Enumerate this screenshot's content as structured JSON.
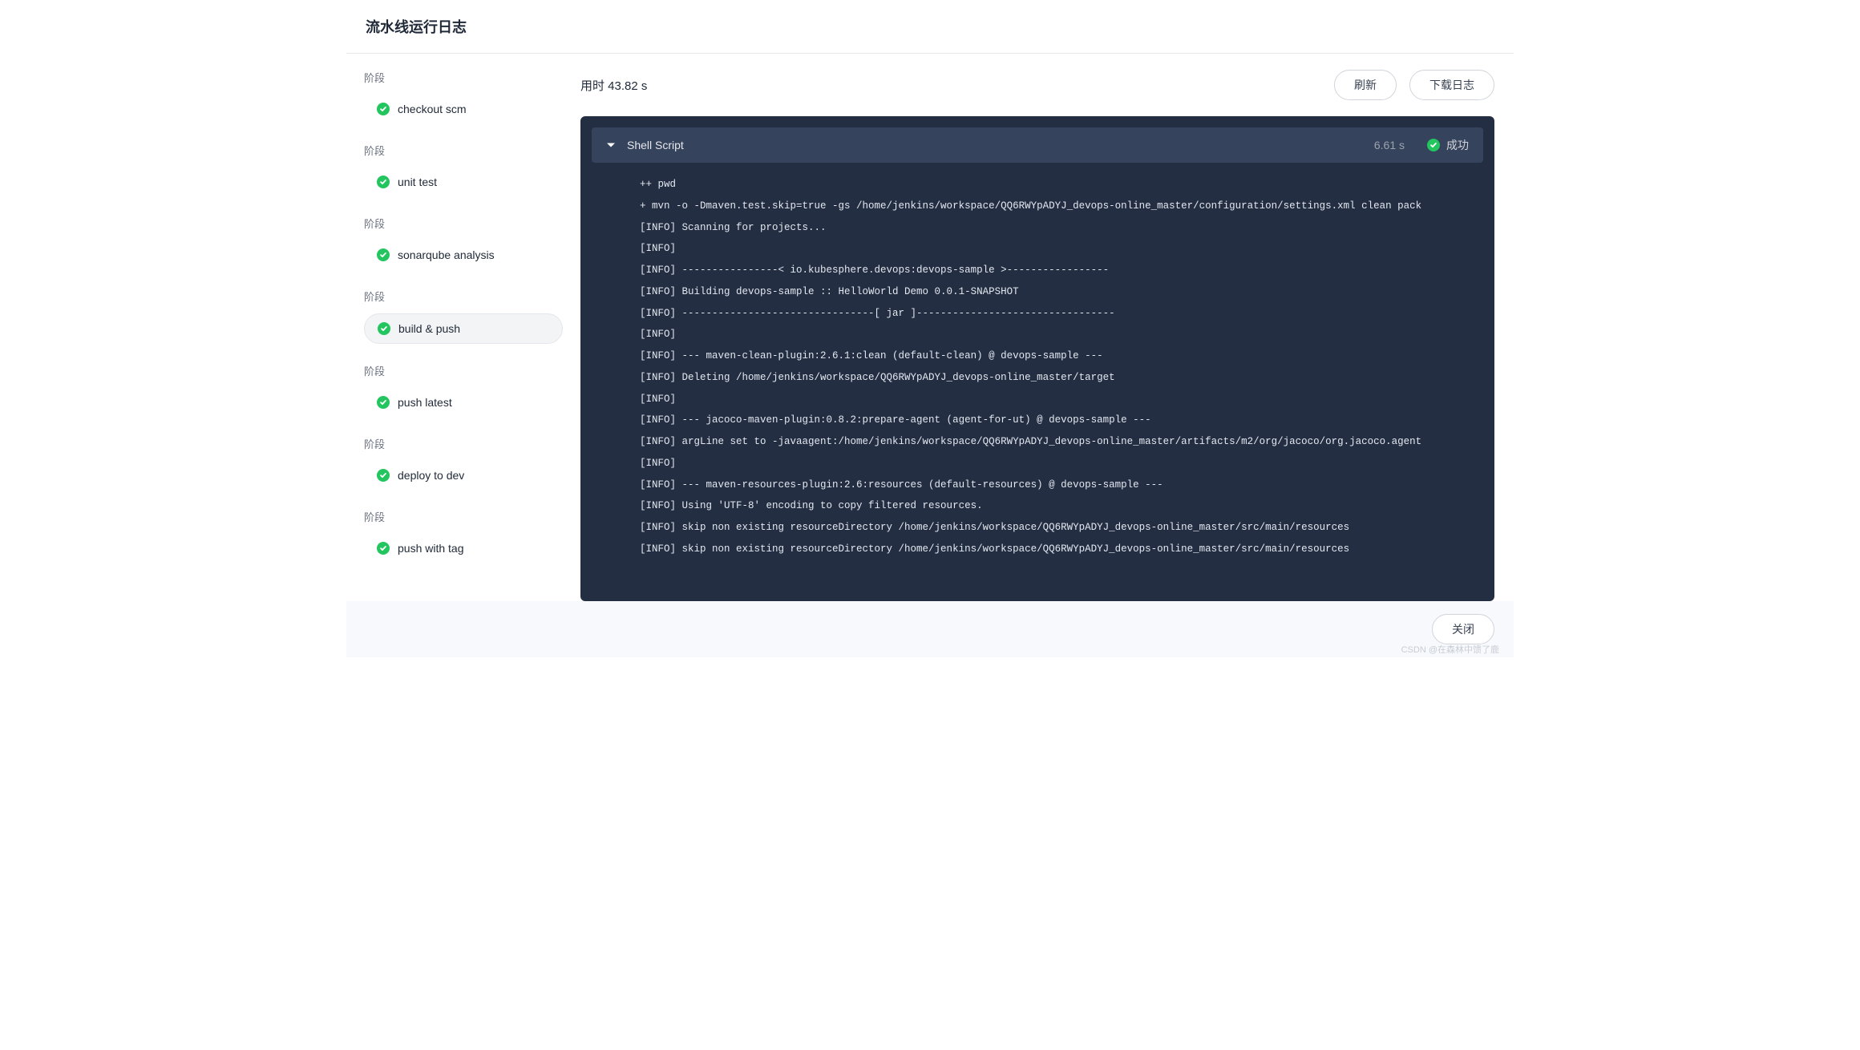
{
  "header": {
    "title": "流水线运行日志"
  },
  "sidebar": {
    "section_label": "阶段",
    "stages": [
      {
        "label": "checkout scm",
        "active": false
      },
      {
        "label": "unit test",
        "active": false
      },
      {
        "label": "sonarqube analysis",
        "active": false
      },
      {
        "label": "build & push",
        "active": true
      },
      {
        "label": "push latest",
        "active": false
      },
      {
        "label": "deploy to dev",
        "active": false
      },
      {
        "label": "push with tag",
        "active": false
      }
    ]
  },
  "main": {
    "duration_label": "用时 43.82 s",
    "refresh_label": "刷新",
    "download_label": "下载日志"
  },
  "step": {
    "name": "Shell Script",
    "duration": "6.61 s",
    "status_label": "成功"
  },
  "log_lines": [
    "++ pwd",
    "+ mvn -o -Dmaven.test.skip=true -gs /home/jenkins/workspace/QQ6RWYpADYJ_devops-online_master/configuration/settings.xml clean pack",
    "[INFO] Scanning for projects...",
    "[INFO]",
    "[INFO] ----------------< io.kubesphere.devops:devops-sample >-----------------",
    "[INFO] Building devops-sample :: HelloWorld Demo 0.0.1-SNAPSHOT",
    "[INFO] --------------------------------[ jar ]---------------------------------",
    "[INFO]",
    "[INFO] --- maven-clean-plugin:2.6.1:clean (default-clean) @ devops-sample ---",
    "[INFO] Deleting /home/jenkins/workspace/QQ6RWYpADYJ_devops-online_master/target",
    "[INFO]",
    "[INFO] --- jacoco-maven-plugin:0.8.2:prepare-agent (agent-for-ut) @ devops-sample ---",
    "[INFO] argLine set to -javaagent:/home/jenkins/workspace/QQ6RWYpADYJ_devops-online_master/artifacts/m2/org/jacoco/org.jacoco.agent",
    "[INFO]",
    "[INFO] --- maven-resources-plugin:2.6:resources (default-resources) @ devops-sample ---",
    "[INFO] Using 'UTF-8' encoding to copy filtered resources.",
    "[INFO] skip non existing resourceDirectory /home/jenkins/workspace/QQ6RWYpADYJ_devops-online_master/src/main/resources",
    "[INFO] skip non existing resourceDirectory /home/jenkins/workspace/QQ6RWYpADYJ_devops-online_master/src/main/resources"
  ],
  "footer": {
    "close_label": "关闭"
  },
  "watermark": "CSDN @在森林中馈了鹿"
}
